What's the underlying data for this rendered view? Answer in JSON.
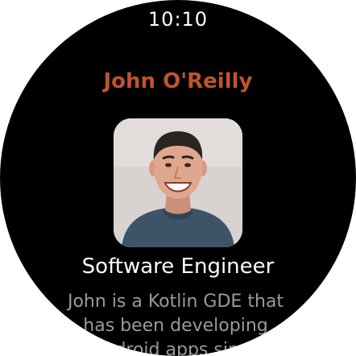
{
  "status": {
    "time": "10:10"
  },
  "profile": {
    "name": "John O'Reilly",
    "title": "Software Engineer",
    "bio": "John is a Kotlin GDE that has been developing Android apps since"
  },
  "colors": {
    "name_accent": "#c0532c",
    "background": "#000000",
    "bio_text": "#9a9a9a"
  },
  "icons": {
    "avatar": "person-photo"
  }
}
